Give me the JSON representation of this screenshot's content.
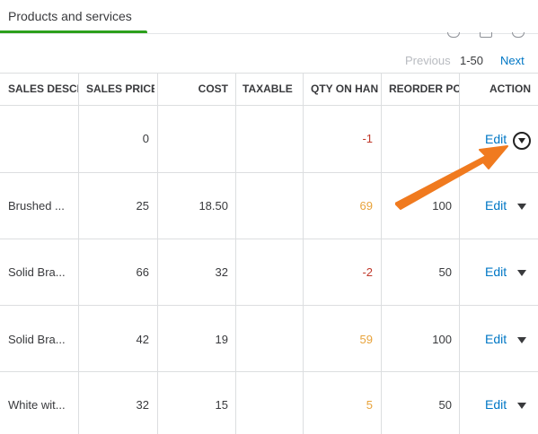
{
  "tab": {
    "title": "Products and services"
  },
  "pager": {
    "prev": "Previous",
    "range": "1-50",
    "next": "Next"
  },
  "table": {
    "headers": [
      "SALES DESCR",
      "SALES PRICE",
      "COST",
      "TAXABLE",
      "QTY ON HAN",
      "REORDER PO",
      "ACTION"
    ],
    "rows": [
      {
        "desc": "",
        "price": "0",
        "cost": "",
        "taxable": "",
        "qty": "-1",
        "reorder": "",
        "action": "Edit"
      },
      {
        "desc": "Brushed ...",
        "price": "25",
        "cost": "18.50",
        "taxable": "",
        "qty": "69",
        "reorder": "100",
        "action": "Edit"
      },
      {
        "desc": "Solid Bra...",
        "price": "66",
        "cost": "32",
        "taxable": "",
        "qty": "-2",
        "reorder": "50",
        "action": "Edit"
      },
      {
        "desc": "Solid Bra...",
        "price": "42",
        "cost": "19",
        "taxable": "",
        "qty": "59",
        "reorder": "100",
        "action": "Edit"
      },
      {
        "desc": "White wit...",
        "price": "32",
        "cost": "15",
        "taxable": "",
        "qty": "5",
        "reorder": "50",
        "action": "Edit"
      }
    ]
  },
  "colors": {
    "accent_green": "#2ca01c",
    "link_blue": "#0077c5",
    "negative_red": "#c0392b",
    "warning_orange": "#e8a33b",
    "arrow_orange": "#f07a1f"
  }
}
